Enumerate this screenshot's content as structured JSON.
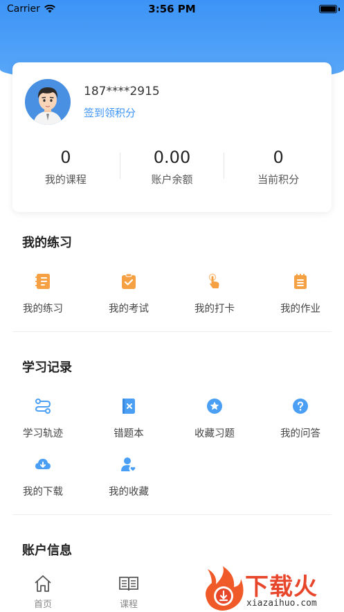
{
  "status_bar": {
    "carrier": "Carrier",
    "time": "3:56 PM"
  },
  "profile": {
    "phone": "187****2915",
    "signin_label": "签到领积分",
    "stats": [
      {
        "value": "0",
        "label": "我的课程"
      },
      {
        "value": "0.00",
        "label": "账户余额"
      },
      {
        "value": "0",
        "label": "当前积分"
      }
    ]
  },
  "practice": {
    "title": "我的练习",
    "items": [
      {
        "label": "我的练习",
        "icon": "notebook-icon"
      },
      {
        "label": "我的考试",
        "icon": "clipboard-check-icon"
      },
      {
        "label": "我的打卡",
        "icon": "tap-finger-icon"
      },
      {
        "label": "我的作业",
        "icon": "notepad-icon"
      }
    ]
  },
  "records": {
    "title": "学习记录",
    "items": [
      {
        "label": "学习轨迹",
        "icon": "route-icon"
      },
      {
        "label": "错题本",
        "icon": "wrong-book-icon"
      },
      {
        "label": "收藏习题",
        "icon": "star-circle-icon"
      },
      {
        "label": "我的问答",
        "icon": "question-circle-icon"
      },
      {
        "label": "我的下载",
        "icon": "cloud-download-icon"
      },
      {
        "label": "我的收藏",
        "icon": "user-heart-icon"
      }
    ]
  },
  "account": {
    "title": "账户信息"
  },
  "tabbar": [
    {
      "label": "首页",
      "icon": "home-icon"
    },
    {
      "label": "课程",
      "icon": "book-icon"
    }
  ],
  "watermark": {
    "text": "下载火",
    "sub": "xiazaihuo.com"
  },
  "colors": {
    "accent": "#3d94f6",
    "icon_orange": "#f5a042",
    "icon_blue": "#4a9ff5",
    "brand_red": "#e8462a"
  }
}
